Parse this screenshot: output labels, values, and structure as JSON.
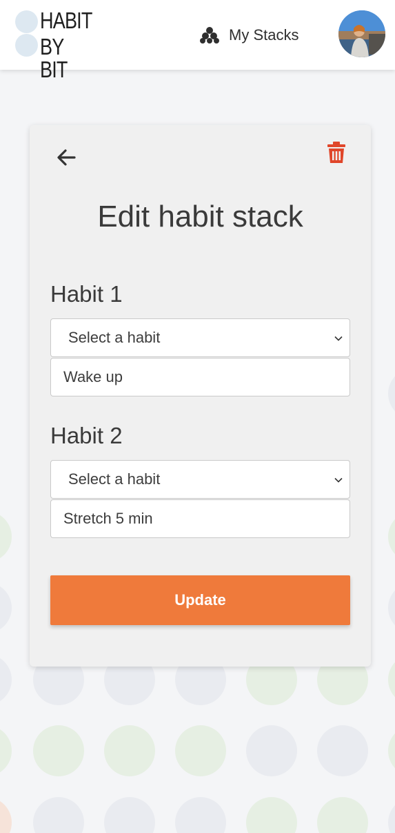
{
  "header": {
    "logo_line1": "HABIT",
    "logo_line2": "BY BIT",
    "nav_stacks_label": "My Stacks",
    "nav_stacks_icon": "stacks-icon",
    "avatar": "user-avatar"
  },
  "card": {
    "title": "Edit habit stack",
    "back_icon": "arrow-left-icon",
    "delete_icon": "trash-icon",
    "habits": [
      {
        "label": "Habit 1",
        "select_value": "Select a habit",
        "input_value": "Wake up"
      },
      {
        "label": "Habit 2",
        "select_value": "Select a habit",
        "input_value": "Stretch 5 min"
      }
    ],
    "submit_label": "Update"
  },
  "colors": {
    "accent": "#ef7a3b",
    "delete": "#e0462a",
    "card_bg": "#f0f0f0"
  }
}
